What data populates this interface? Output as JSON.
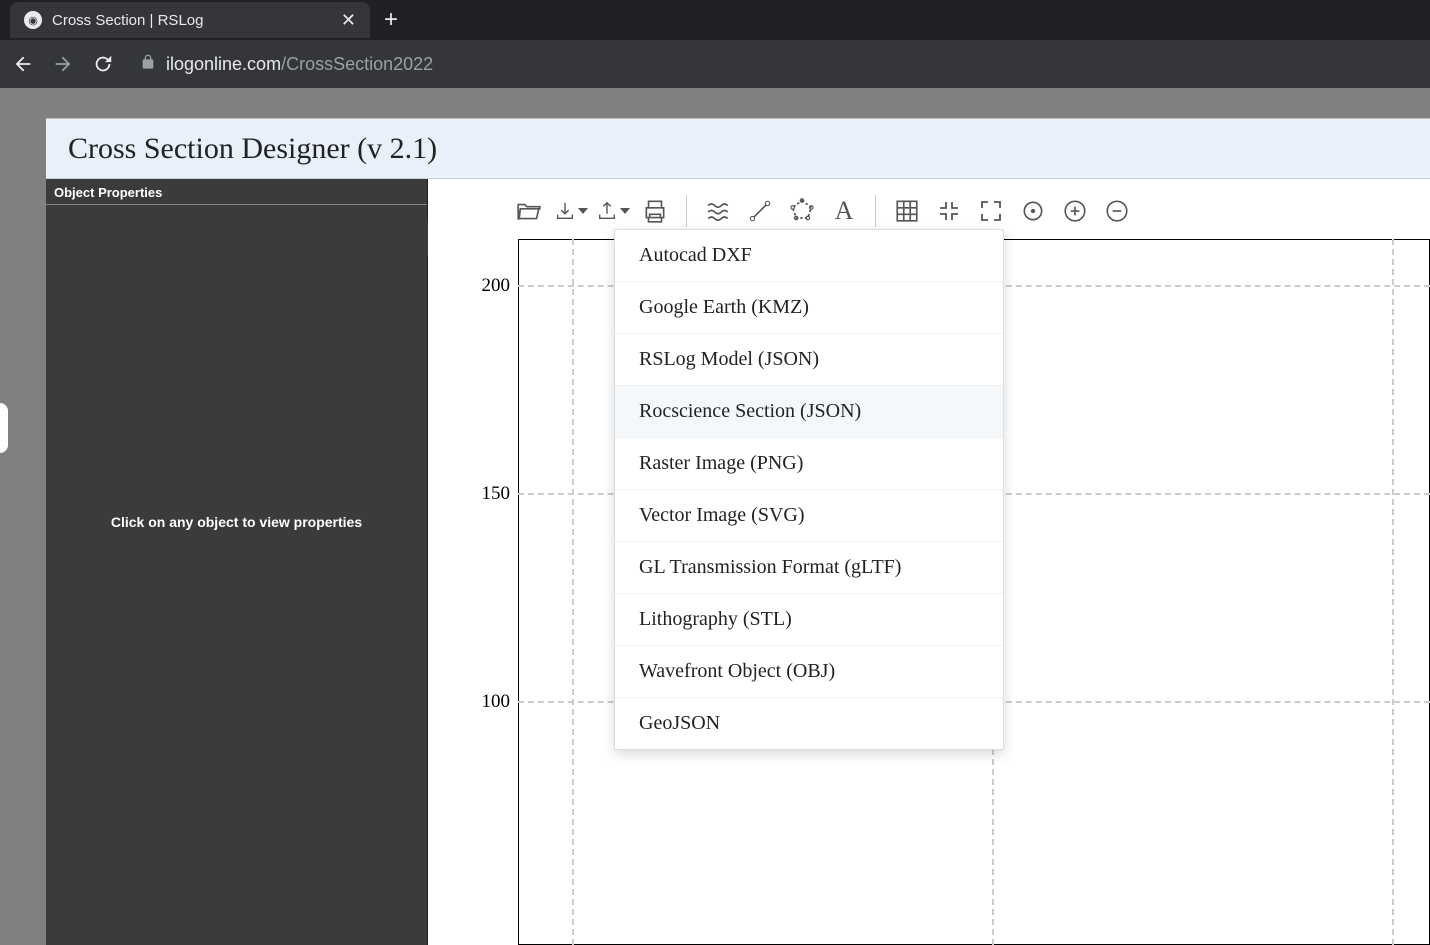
{
  "browser": {
    "tab_title": "Cross Section | RSLog",
    "url_domain": "ilogonline.com",
    "url_path": "/CrossSection2022"
  },
  "app": {
    "header_title": "Cross Section Designer (v 2.1)",
    "sidebar": {
      "title": "Object Properties",
      "hint": "Click on any object to view properties"
    },
    "y_axis": {
      "ticks": [
        "200",
        "150",
        "100"
      ]
    },
    "export_menu": {
      "items": [
        "Autocad DXF",
        "Google Earth (KMZ)",
        "RSLog Model (JSON)",
        "Rocscience Section (JSON)",
        "Raster Image (PNG)",
        "Vector Image (SVG)",
        "GL Transmission Format (gLTF)",
        "Lithography (STL)",
        "Wavefront Object (OBJ)",
        "GeoJSON"
      ],
      "highlighted_index": 3
    }
  }
}
